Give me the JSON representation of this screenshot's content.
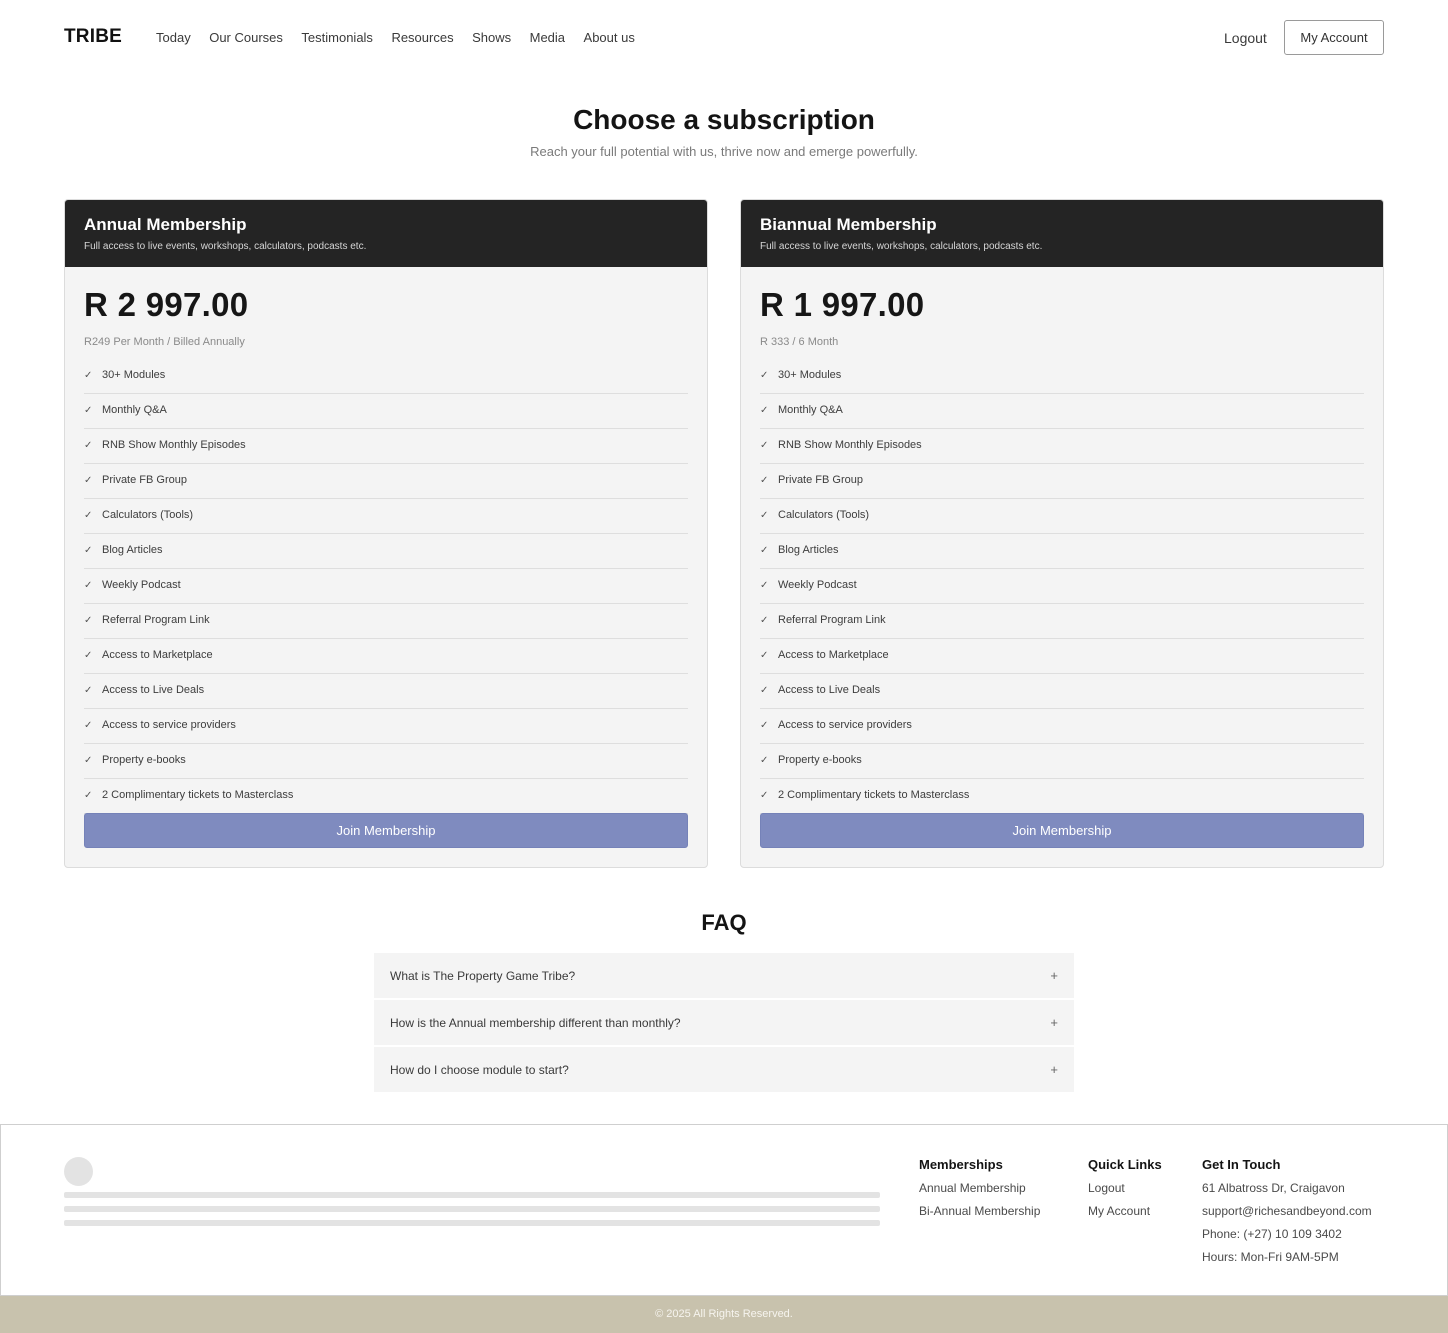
{
  "header": {
    "logo": "TRIBE",
    "nav": [
      "Today",
      "Our Courses",
      "Testimonials",
      "Resources",
      "Shows",
      "Media",
      "About us"
    ],
    "logout_label": "Logout",
    "account_label": "My Account"
  },
  "hero": {
    "title": "Choose a subscription",
    "subtitle": "Reach your full potential with us, thrive now and emerge powerfully."
  },
  "plans": [
    {
      "title": "Annual Membership",
      "description": "Full access to live events, workshops, calculators, podcasts etc.",
      "price": "R 2 997.00",
      "billing": "R249 Per Month / Billed Annually",
      "features": [
        "30+ Modules",
        "Monthly Q&A",
        "RNB Show Monthly Episodes",
        "Private FB Group",
        "Calculators (Tools)",
        "Blog Articles",
        "Weekly Podcast",
        "Referral Program Link",
        "Access to Marketplace",
        "Access to Live Deals",
        "Access to service providers",
        "Property e-books",
        "2 Complimentary tickets to Masterclass"
      ],
      "button": "Join Membership"
    },
    {
      "title": "Biannual Membership",
      "description": "Full access to live events, workshops, calculators, podcasts etc.",
      "price": "R 1 997.00",
      "billing": "R 333 / 6 Month",
      "features": [
        "30+ Modules",
        "Monthly Q&A",
        "RNB Show Monthly Episodes",
        "Private FB Group",
        "Calculators (Tools)",
        "Blog Articles",
        "Weekly Podcast",
        "Referral Program Link",
        "Access to Marketplace",
        "Access to Live Deals",
        "Access to service providers",
        "Property e-books",
        "2 Complimentary tickets to Masterclass"
      ],
      "button": "Join Membership"
    }
  ],
  "faq": {
    "title": "FAQ",
    "items": [
      {
        "question": "What is The Property Game Tribe?",
        "icon": "plus-icon",
        "symbol": "+"
      },
      {
        "question": "How is the Annual membership different than monthly?",
        "icon": "plus-icon",
        "symbol": "+"
      },
      {
        "question": "How do I choose module to start?",
        "icon": "plus-icon",
        "symbol": "+"
      }
    ]
  },
  "footer": {
    "memberships": {
      "heading": "Memberships",
      "links": [
        "Annual Membership",
        "Bi-Annual Membership"
      ]
    },
    "quick_links": {
      "heading": "Quick Links",
      "links": [
        "Logout",
        "My Account"
      ]
    },
    "contact": {
      "heading": "Get In Touch",
      "lines": [
        "61 Albatross Dr, Craigavon",
        "support@richesandbeyond.com",
        "Phone: (+27) 10 109 3402",
        "Hours: Mon-Fri 9AM-5PM"
      ]
    },
    "copyright": "© 2025 All Rights Reserved."
  },
  "colors": {
    "card_header": "#242424",
    "button": "#7f8bbf",
    "bottom_bar": "#c8c2ad",
    "card_bg": "#f4f4f4"
  }
}
